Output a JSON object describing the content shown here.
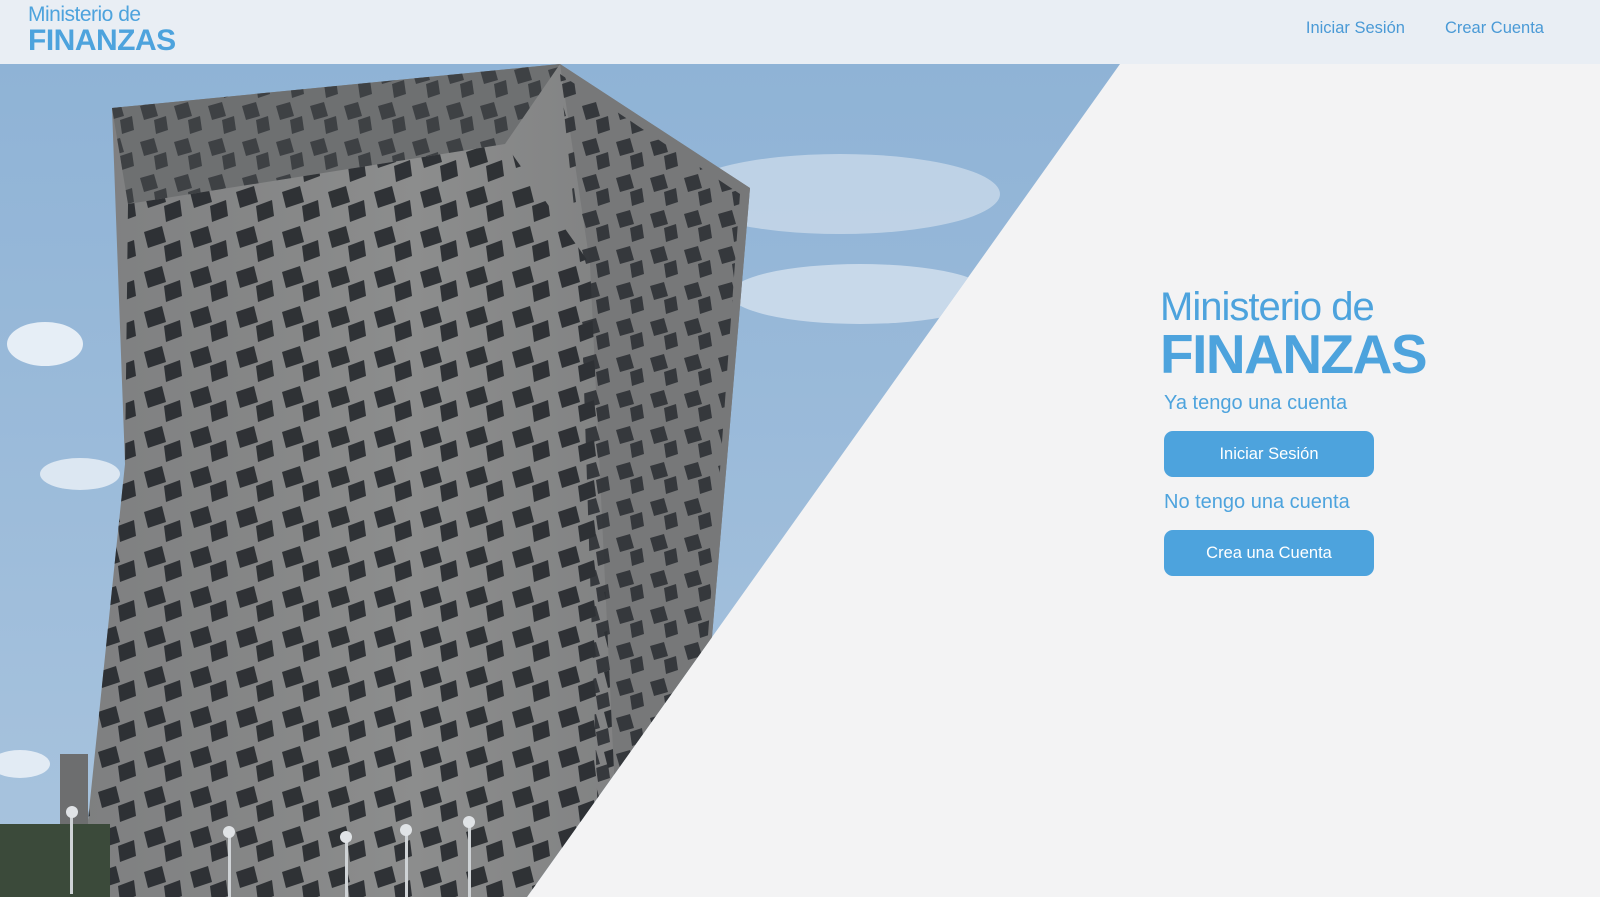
{
  "header": {
    "logo_line1": "Ministerio de",
    "logo_line2": "FINANZAS",
    "nav": {
      "login": "Iniciar Sesión",
      "register": "Crear Cuenta"
    }
  },
  "main": {
    "logo_line1": "Ministerio de",
    "logo_line2": "FINANZAS",
    "have_account_text": "Ya tengo una cuenta",
    "login_button": "Iniciar Sesión",
    "no_account_text": "No tengo una cuenta",
    "register_button": "Crea una Cuenta"
  },
  "colors": {
    "brand_blue": "#4da3dd",
    "topbar_bg": "#e9eef4",
    "page_bg": "#f3f3f4"
  }
}
